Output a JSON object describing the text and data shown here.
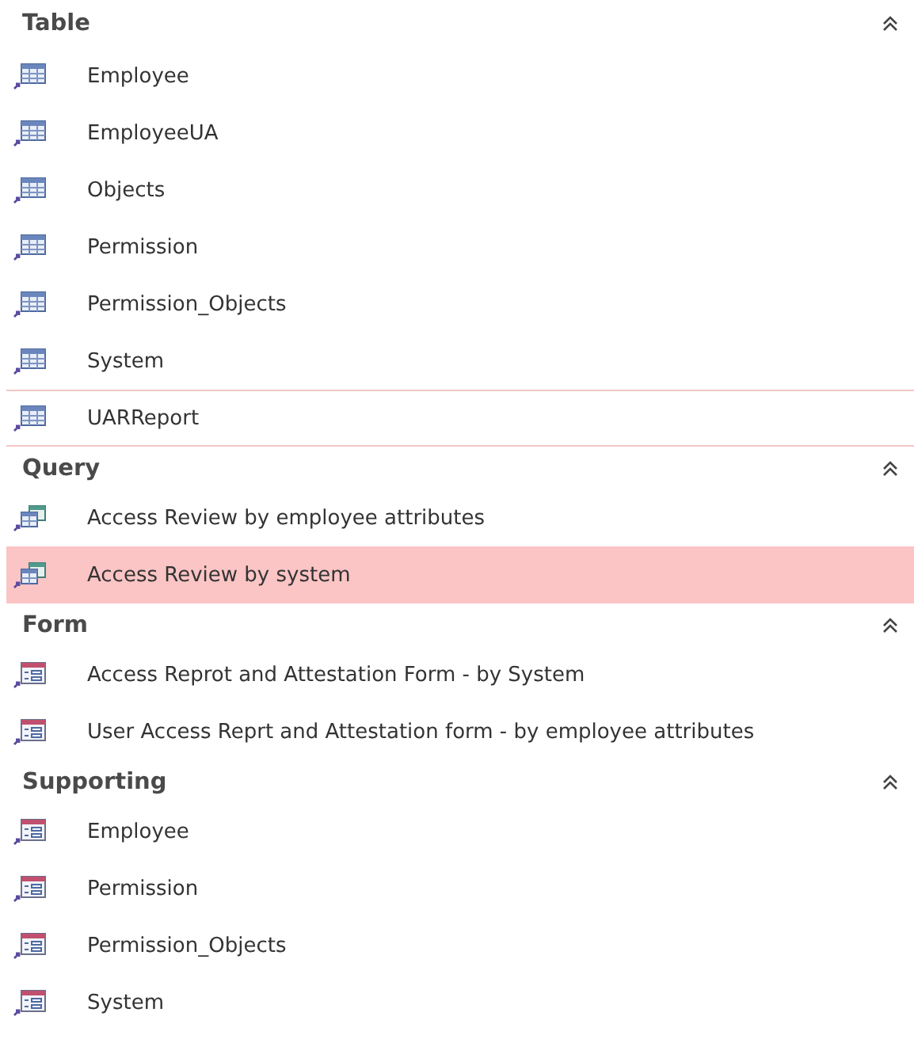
{
  "groups": [
    {
      "title": "Table",
      "kind": "table",
      "expanded": true,
      "items": [
        {
          "label": "Employee",
          "selected": false,
          "focused": false
        },
        {
          "label": "EmployeeUA",
          "selected": false,
          "focused": false
        },
        {
          "label": "Objects",
          "selected": false,
          "focused": false
        },
        {
          "label": "Permission",
          "selected": false,
          "focused": false
        },
        {
          "label": "Permission_Objects",
          "selected": false,
          "focused": false
        },
        {
          "label": "System",
          "selected": false,
          "focused": false
        },
        {
          "label": "UARReport",
          "selected": false,
          "focused": true
        }
      ]
    },
    {
      "title": "Query",
      "kind": "query",
      "expanded": true,
      "items": [
        {
          "label": "Access Review by employee attributes",
          "selected": false,
          "focused": false
        },
        {
          "label": "Access Review by system",
          "selected": true,
          "focused": false
        }
      ]
    },
    {
      "title": "Form",
      "kind": "form",
      "expanded": true,
      "items": [
        {
          "label": "Access Reprot and Attestation Form - by System",
          "selected": false,
          "focused": false
        },
        {
          "label": "User Access Reprt and Attestation form - by employee attributes",
          "selected": false,
          "focused": false
        }
      ]
    },
    {
      "title": "Supporting",
      "kind": "form",
      "expanded": true,
      "items": [
        {
          "label": "Employee",
          "selected": false,
          "focused": false
        },
        {
          "label": "Permission",
          "selected": false,
          "focused": false
        },
        {
          "label": "Permission_Objects",
          "selected": false,
          "focused": false
        },
        {
          "label": "System",
          "selected": false,
          "focused": false
        }
      ]
    }
  ]
}
